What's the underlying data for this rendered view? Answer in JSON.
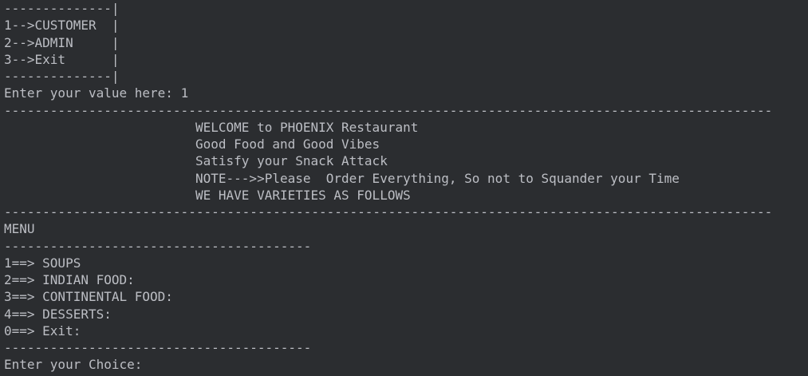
{
  "console": {
    "box_top": "--------------|",
    "options": [
      "1-->CUSTOMER  |",
      "2-->ADMIN     |",
      "3-->Exit      |"
    ],
    "box_bottom": "--------------|",
    "first_prompt": "Enter your value here: ",
    "first_input": "1",
    "long_rule": "----------------------------------------------------------------------------------------------------",
    "banner": [
      "WELCOME to PHOENIX Restaurant",
      "Good Food and Good Vibes",
      "Satisfy your Snack Attack",
      "NOTE--->>Please  Order Everything, So not to Squander your Time",
      "WE HAVE VARIETIES AS FOLLOWS"
    ],
    "menu_title": "MENU",
    "short_rule": "----------------------------------------",
    "menu_items": [
      "1==> SOUPS",
      "2==> INDIAN FOOD:",
      "3==> CONTINENTAL FOOD:",
      "4==> DESSERTS:",
      "0==> Exit:"
    ],
    "choice_prompt": "Enter your Choice:"
  }
}
